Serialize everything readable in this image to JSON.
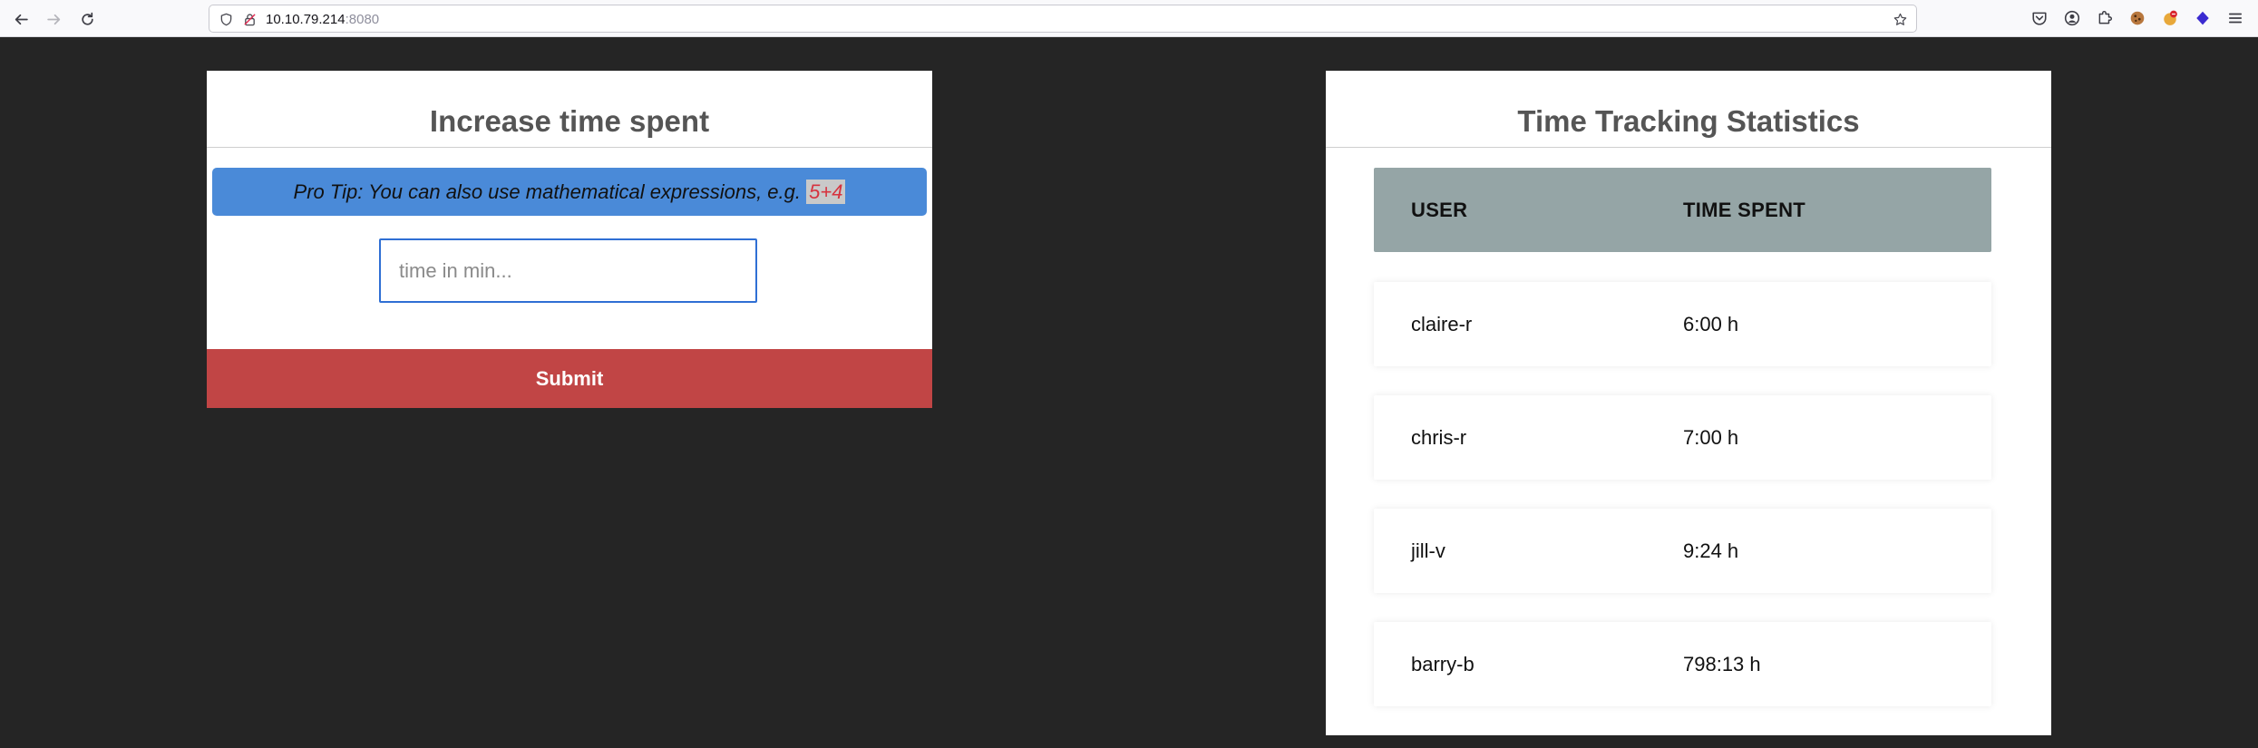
{
  "browser": {
    "url_host": "10.10.79.214",
    "url_port": ":8080",
    "icons": [
      "back-arrow-icon",
      "forward-arrow-icon",
      "reload-icon",
      "shield-icon",
      "lock-icon",
      "bookmark-star-icon",
      "pocket-icon",
      "account-icon",
      "extensions-icon",
      "cookie-extension-icon",
      "extension-badge-icon",
      "extension-purple-icon",
      "menu-icon"
    ]
  },
  "time_form": {
    "title": "Increase time spent",
    "tip_text": "Pro Tip: You can also use mathematical expressions, e.g. ",
    "tip_example": "5+4",
    "input_placeholder": "time in min...",
    "input_value": "",
    "submit_label": "Submit"
  },
  "stats": {
    "title": "Time Tracking Statistics",
    "columns": [
      "USER",
      "TIME SPENT"
    ],
    "rows": [
      {
        "user": "claire-r",
        "time": "6:00 h"
      },
      {
        "user": "chris-r",
        "time": "7:00 h"
      },
      {
        "user": "jill-v",
        "time": "9:24 h"
      },
      {
        "user": "barry-b",
        "time": "798:13 h"
      }
    ]
  },
  "colors": {
    "page_bg": "#252525",
    "tip_bg": "#4a8ad8",
    "submit_bg": "#c14545",
    "table_header_bg": "#95a5a6",
    "code_text": "#d6333f"
  }
}
